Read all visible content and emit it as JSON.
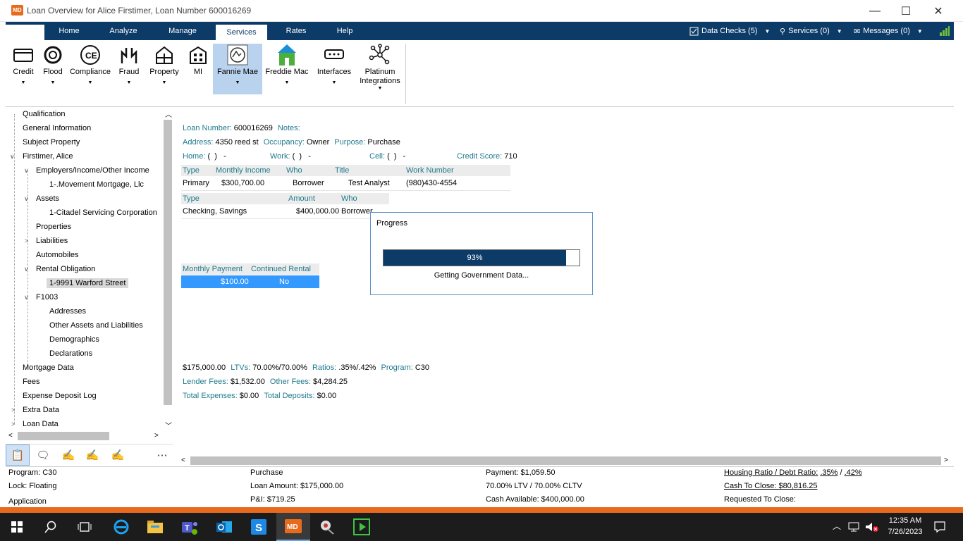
{
  "window": {
    "logo": "MD",
    "title": "Loan Overview for Alice Firstimer, Loan Number 600016269",
    "minimize": "—",
    "maximize": "☐",
    "close": "✕"
  },
  "tabs": [
    "Home",
    "Analyze",
    "Manage",
    "Services",
    "Rates",
    "Help"
  ],
  "active_tab": "Services",
  "top_right": {
    "data_checks": "Data Checks (5)",
    "services": "Services (0)",
    "messages": "Messages (0)"
  },
  "tools": [
    {
      "label": "Credit",
      "icon": "credit-card-icon"
    },
    {
      "label": "Flood",
      "icon": "lifebuoy-icon"
    },
    {
      "label": "Compliance",
      "icon": "compliance-ce-icon"
    },
    {
      "label": "Fraud",
      "icon": "fraud-hands-icon"
    },
    {
      "label": "Property",
      "icon": "property-house-icon"
    },
    {
      "label": "MI",
      "icon": "mi-building-icon"
    },
    {
      "label": "Fannie Mae",
      "icon": "fannie-mae-icon"
    },
    {
      "label": "Freddie Mac",
      "icon": "freddie-mac-icon"
    },
    {
      "label": "Interfaces",
      "icon": "interfaces-icon"
    },
    {
      "label": "Platinum\nIntegrations",
      "icon": "network-nodes-icon"
    }
  ],
  "nav": [
    "Qualification",
    "General Information",
    "Subject Property",
    "Firstimer, Alice",
    "Employers/Income/Other Income",
    "1-.Movement Mortgage, Llc",
    "Assets",
    "1-Citadel Servicing Corporation",
    "Properties",
    "Liabilities",
    "Automobiles",
    "Rental Obligation",
    "1-9991 Warford Street",
    "F1003",
    "Addresses",
    "Other Assets and Liabilities",
    "Demographics",
    "Declarations",
    "Mortgage Data",
    "Fees",
    "Expense Deposit Log",
    "Extra Data",
    "Loan Data"
  ],
  "overview": {
    "loan_number_label": "Loan Number:",
    "loan_number": "600016269",
    "notes_label": "Notes:",
    "address_label": "Address:",
    "address": "4350 reed st",
    "occupancy_label": "Occupancy:",
    "occupancy": "Owner",
    "purpose_label": "Purpose:",
    "purpose": "Purchase",
    "home_label": "Home:",
    "home": "(  )   -",
    "work_label": "Work:",
    "work": "(  )   -",
    "cell_label": "Cell:",
    "cell": "(  )   -",
    "credit_label": "Credit Score:",
    "credit": "710",
    "income_headers": [
      "Type",
      "Monthly Income",
      "Who",
      "Title",
      "Work Number"
    ],
    "income_row": [
      "Primary",
      "$300,700.00",
      "Borrower",
      "Test Analyst",
      "(980)430-4554"
    ],
    "asset_headers": [
      "Type",
      "Amount",
      "Who"
    ],
    "asset_row": [
      "Checking, Savings",
      "$400,000.00",
      "Borrower"
    ],
    "rental_headers": [
      "Monthly Payment",
      "Continued Rental"
    ],
    "rental_row": [
      "$100.00",
      "No"
    ],
    "amount": "$175,000.00",
    "ltv_label": "LTVs:",
    "ltv": "70.00%/70.00%",
    "ratios_label": "Ratios:",
    "ratios": ".35%/.42%",
    "program_label": "Program:",
    "program": "C30",
    "lender_label": "Lender Fees:",
    "lender": "$1,532.00",
    "other_label": "Other Fees:",
    "other": "$4,284.25",
    "exp_label": "Total Expenses:",
    "exp": "$0.00",
    "dep_label": "Total Deposits:",
    "dep": "$0.00"
  },
  "progress": {
    "title": "Progress",
    "percent_text": "93%",
    "value": 0.93,
    "message": "Getting Government Data..."
  },
  "status": {
    "program": "Program: C30",
    "lock": "Lock: Floating",
    "stage": "Application",
    "purpose": "Purchase",
    "loan_amount": "Loan Amount: $175,000.00",
    "pi": "P&I: $719.25",
    "payment": "Payment: $1,059.50",
    "ltv": "70.00% LTV / 70.00% CLTV",
    "cash_avail": "Cash Available: $400,000.00",
    "ratio_label": "Housing Ratio / Debt Ratio:",
    "ratio_h": ".35%",
    "ratio_sep": "/",
    "ratio_d": ".42%",
    "cash_close": "Cash To Close: $80,816.25",
    "req_close": "Requested To Close:"
  },
  "clock": {
    "time": "12:35 AM",
    "date": "7/26/2023"
  },
  "colors": {
    "brand": "#e86a1c",
    "nav": "#0d3b68",
    "label": "#1f7a8c",
    "selection": "#3399ff"
  }
}
